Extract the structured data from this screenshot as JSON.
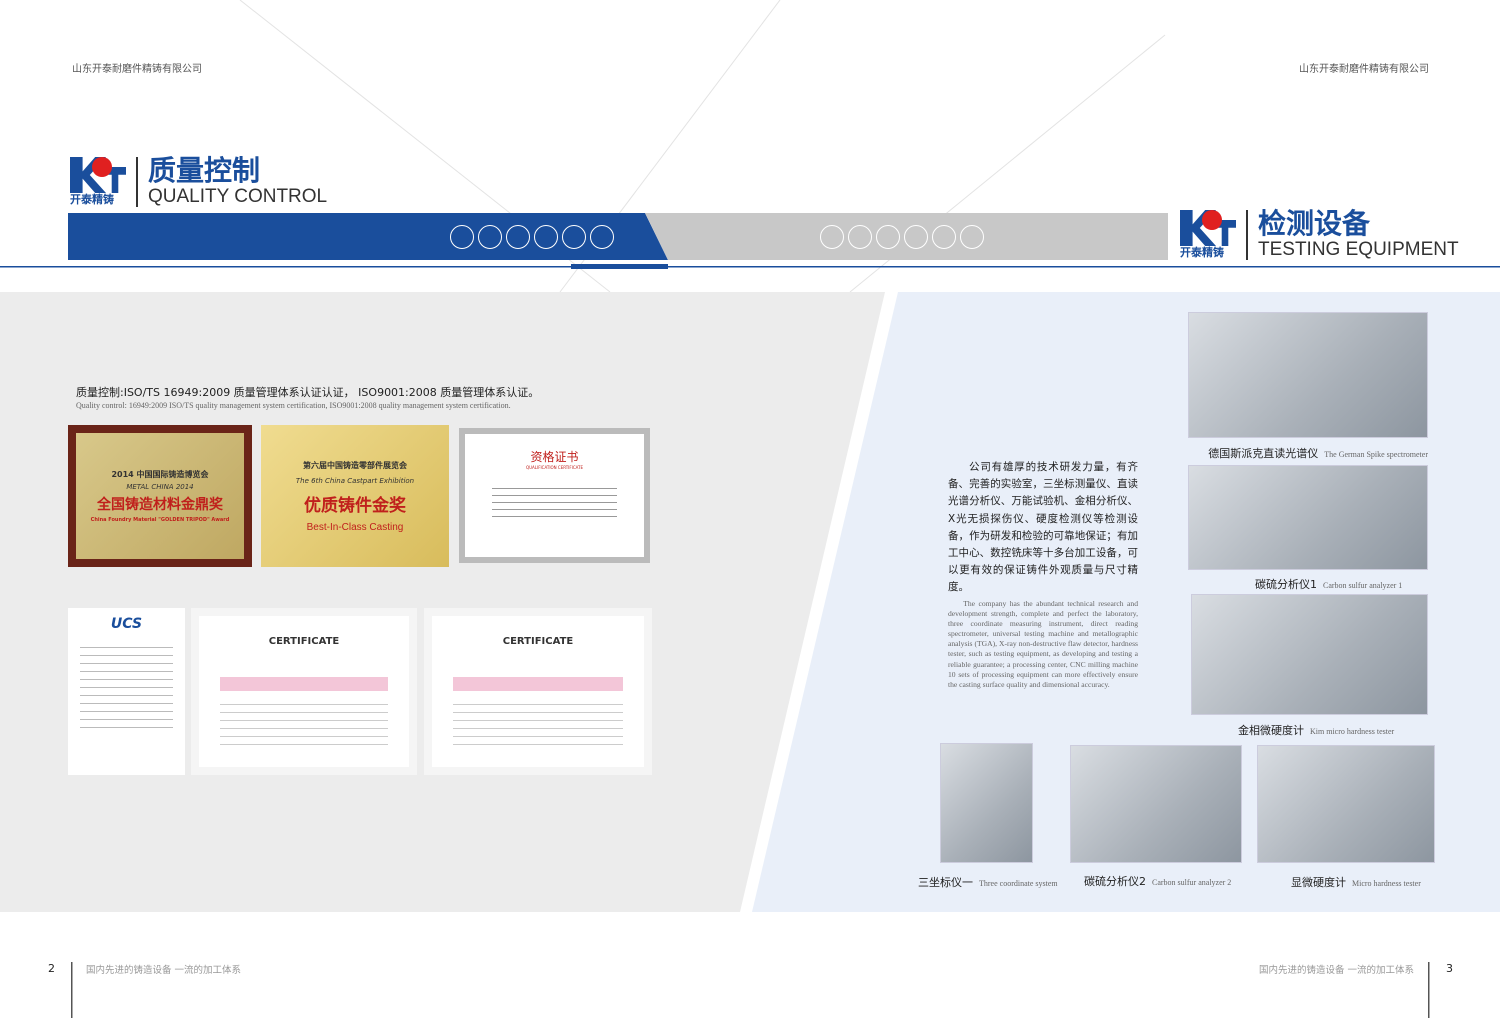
{
  "header": {
    "company_left": "山东开泰耐磨件精铸有限公司",
    "company_right": "山东开泰耐磨件精铸有限公司"
  },
  "brand": {
    "logo_text": "开泰精铸"
  },
  "left": {
    "section_zh": "质量控制",
    "section_en": "QUALITY CONTROL",
    "intro_zh": "质量控制:ISO/TS 16949:2009 质量管理体系认证认证， ISO9001:2008 质量管理体系认证。",
    "intro_en": "Quality control: 16949:2009 ISO/TS quality management system certification, ISO9001:2008 quality management system certification.",
    "certificates": [
      {
        "top": "2014 中国国际铸造博览会",
        "sub": "METAL CHINA 2014",
        "main": "全国铸造材料金鼎奖",
        "en": "China Foundry Material \"GOLDEN TRIPOD\" Award"
      },
      {
        "top": "第六届中国铸造零部件展览会",
        "sub": "The 6th China Castpart Exhibition",
        "main": "优质铸件金奖",
        "en": "Best-In-Class Casting"
      },
      {
        "top": "资格证书",
        "sub": "QUALIFICATION CERTIFICATE"
      },
      {
        "top": "UCS"
      },
      {
        "top": "CERTIFICATE"
      },
      {
        "top": "CERTIFICATE"
      }
    ]
  },
  "right": {
    "section_zh": "检测设备",
    "section_en": "TESTING EQUIPMENT",
    "body_zh": "公司有雄厚的技术研发力量，有齐备、完善的实验室，三坐标测量仪、直读光谱分析仪、万能试验机、金相分析仪、X光无损探伤仪、硬度检测仪等检测设备，作为研发和检验的可靠地保证；有加工中心、数控铣床等十多台加工设备，可以更有效的保证铸件外观质量与尺寸精度。",
    "body_en": "The company has the abundant technical research and development strength, complete and perfect the laboratory, three coordinate measuring instrument, direct reading spectrometer, universal testing machine and metallographic analysis (TGA), X-ray non-destructive flaw detector, hardness tester, such as testing equipment, as developing and testing a reliable guarantee; a processing center, CNC milling machine 10 sets of processing equipment can more effectively ensure the casting surface quality and dimensional accuracy.",
    "photos": [
      {
        "zh": "德国斯派克直读光谱仪",
        "en": "The German Spike spectrometer"
      },
      {
        "zh": "碳硫分析仪1",
        "en": "Carbon sulfur analyzer 1"
      },
      {
        "zh": "金相微硬度计",
        "en": "Kim micro hardness tester"
      },
      {
        "zh": "三坐标仪一",
        "en": "Three coordinate system"
      },
      {
        "zh": "碳硫分析仪2",
        "en": "Carbon sulfur analyzer 2"
      },
      {
        "zh": "显微硬度计",
        "en": "Micro hardness tester"
      }
    ]
  },
  "footer": {
    "page_left": "2",
    "page_right": "3",
    "slogan_left": "国内先进的铸造设备 一流的加工体系",
    "slogan_right": "国内先进的铸造设备 一流的加工体系"
  },
  "colors": {
    "brand_blue": "#1a4e9c",
    "band_gray": "#c8c8c8",
    "panel_gray": "#ececec",
    "panel_blue": "#e9eff9"
  }
}
